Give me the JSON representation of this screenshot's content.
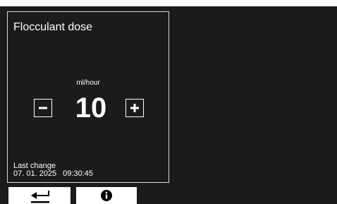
{
  "panel": {
    "title": "Flocculant dose",
    "unit": "ml/hour",
    "value": "10",
    "last_change_label": "Last change",
    "last_change_date": "07. 01. 2025",
    "last_change_time": "09:30:45"
  },
  "icons": {
    "decrease": "minus-icon",
    "increase": "plus-icon",
    "back": "return-arrow-icon",
    "info": "info-icon"
  },
  "colors": {
    "background": "#1b1b1b",
    "foreground": "#ffffff",
    "button_bar": "#ffffff"
  }
}
